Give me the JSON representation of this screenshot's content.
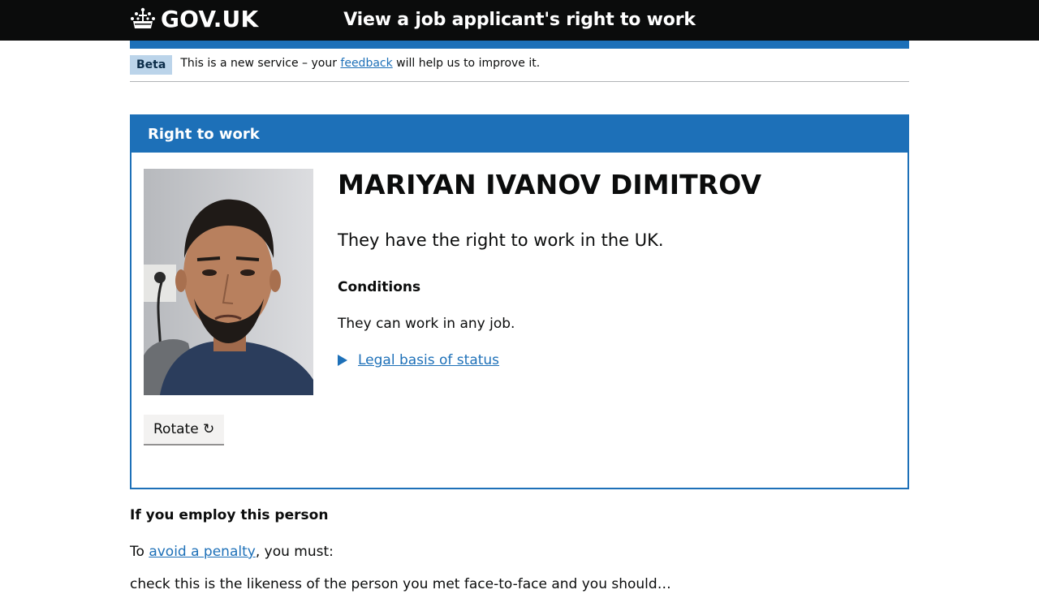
{
  "header": {
    "logo_text": "GOV.UK",
    "service_name": "View a job applicant's right to work"
  },
  "phase_banner": {
    "tag": "Beta",
    "text_before": "This is a new service – your",
    "link": "feedback",
    "text_after": "will help us to improve it."
  },
  "panel": {
    "title": "Right to work",
    "rotate_label": "Rotate ↻",
    "person_name": "MARIYAN IVANOV DIMITROV",
    "status": "They have the right to work in the UK.",
    "conditions_heading": "Conditions",
    "conditions_text": "They can work in any job.",
    "details_summary": "Legal basis of status"
  },
  "employ": {
    "heading": "If you employ this person",
    "text_before": "To",
    "link": "avoid a penalty",
    "text_after": ", you must:",
    "cut_off_line": "check this is the likeness of the person you met face-to-face and you should…"
  },
  "colors": {
    "header_bg": "#0b0c0c",
    "brand_blue": "#1d70b8",
    "tag_bg": "#bbd4ea",
    "button_bg": "#f3f2f1"
  }
}
